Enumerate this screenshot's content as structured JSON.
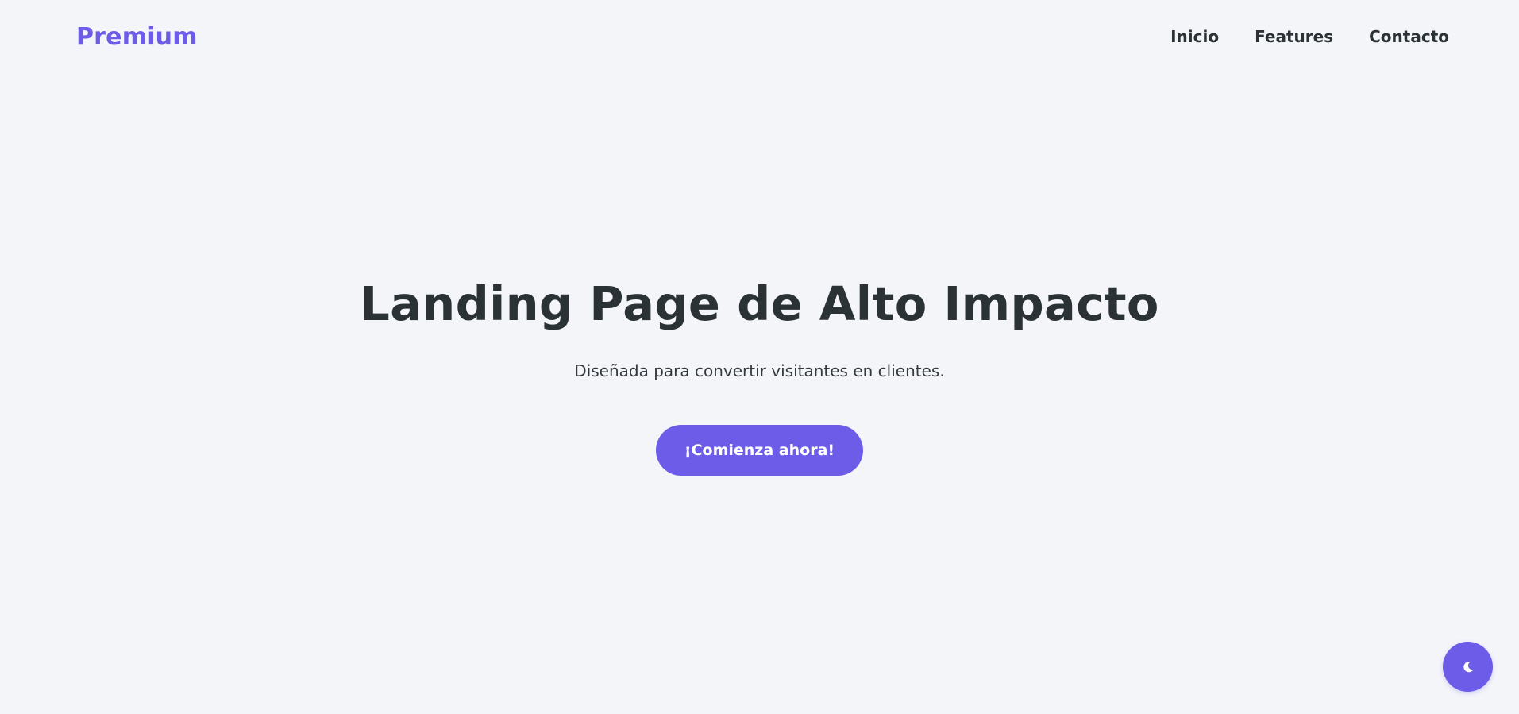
{
  "navbar": {
    "brand": "Premium",
    "links": [
      "Inicio",
      "Features",
      "Contacto"
    ]
  },
  "hero": {
    "title": "Landing Page de Alto Impacto",
    "subtitle": "Diseñada para convertir visitantes en clientes.",
    "cta_label": "¡Comienza ahora!"
  },
  "theme_toggle": {
    "icon": "moon-icon"
  },
  "colors": {
    "accent": "#6c5ce7",
    "background": "#f4f5f9",
    "text": "#2b3236"
  }
}
